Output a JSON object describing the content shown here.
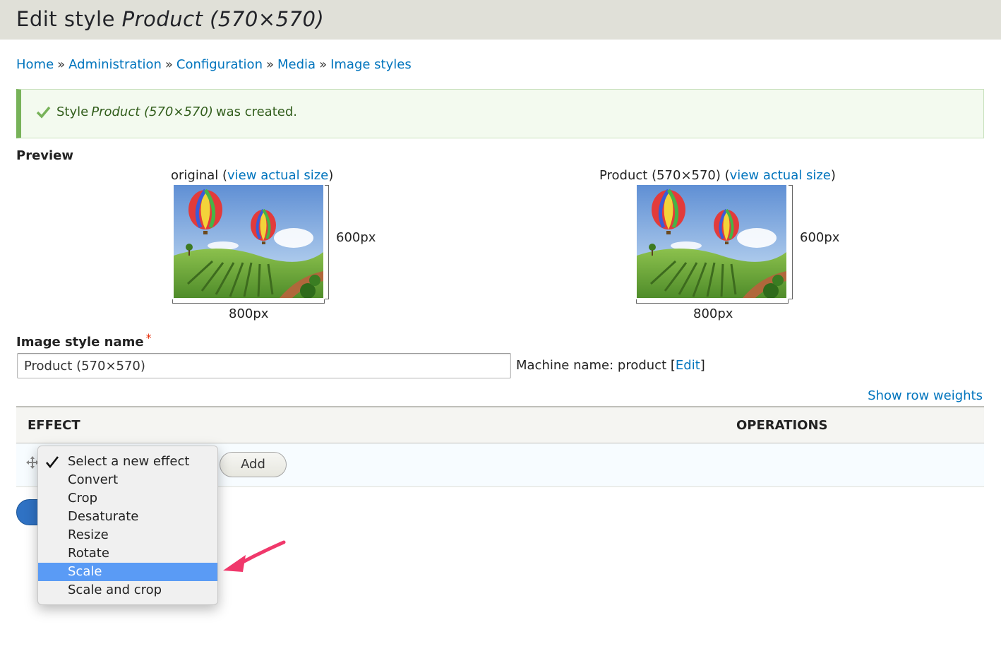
{
  "header": {
    "title_prefix": "Edit style",
    "title_name": "Product (570×570)"
  },
  "breadcrumb": {
    "items": [
      "Home",
      "Administration",
      "Configuration",
      "Media",
      "Image styles"
    ],
    "separator": "»"
  },
  "message": {
    "prefix": "Style",
    "name": "Product (570×570)",
    "suffix": "was created."
  },
  "preview": {
    "label": "Preview",
    "original": {
      "caption": "original",
      "link": "view actual size",
      "width_label": "800px",
      "height_label": "600px"
    },
    "derivative": {
      "caption": "Product (570×570)",
      "link": "view actual size",
      "width_label": "800px",
      "height_label": "600px"
    }
  },
  "name_field": {
    "label": "Image style name",
    "required_mark": "*",
    "value": "Product (570×570)",
    "machine_prefix": "Machine name: product",
    "machine_edit": "Edit"
  },
  "table": {
    "show_row_weights": "Show row weights",
    "columns": [
      "EFFECT",
      "OPERATIONS"
    ],
    "add_button": "Add"
  },
  "effect_select": {
    "options": [
      "Select a new effect",
      "Convert",
      "Crop",
      "Desaturate",
      "Resize",
      "Rotate",
      "Scale",
      "Scale and crop"
    ],
    "checked_option": "Select a new effect",
    "highlighted_option": "Scale"
  },
  "colors": {
    "link": "#0074bd",
    "header_bg": "#e0e0d8",
    "message_bg": "#f3faef",
    "message_border": "#77b259",
    "highlight": "#5a9bf5",
    "primary_button": "#2f72c4",
    "annotation_arrow": "#f0386b"
  },
  "icons": {
    "message": "check-icon",
    "drag": "drag-handle-icon",
    "selected": "checkmark-icon",
    "annotation": "arrow-icon"
  }
}
